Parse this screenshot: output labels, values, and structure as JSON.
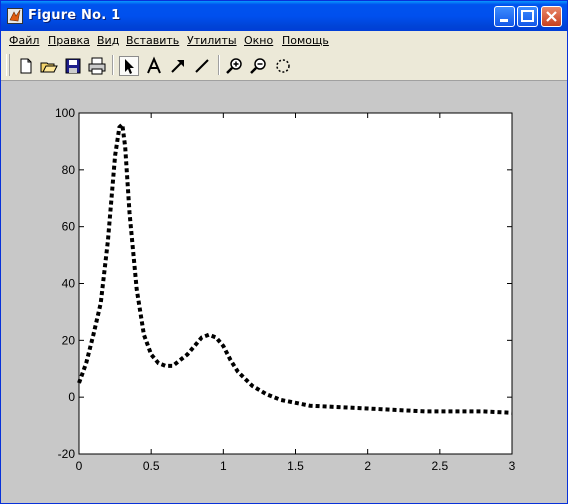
{
  "window": {
    "title": "Figure No. 1",
    "title_icon": "matlab-logo-icon",
    "controls": [
      "minimize-icon",
      "maximize-icon",
      "close-icon"
    ]
  },
  "menu": {
    "items": [
      "Файл",
      "Правка",
      "Вид",
      "Вставить",
      "Утилиты",
      "Окно",
      "Помощь"
    ]
  },
  "toolbar": {
    "buttons": [
      "new-file-icon",
      "open-folder-icon",
      "save-icon",
      "print-icon",
      "select-arrow-icon",
      "text-tool-icon",
      "arrow-tool-icon",
      "line-tool-icon",
      "zoom-in-icon",
      "zoom-out-icon",
      "rotate-3d-icon"
    ],
    "active": "select-arrow-icon"
  },
  "chart_data": {
    "type": "line",
    "title": "",
    "xlabel": "",
    "ylabel": "",
    "xlim": [
      0,
      3
    ],
    "ylim": [
      -20,
      100
    ],
    "xticks": [
      0,
      0.5,
      1,
      1.5,
      2,
      2.5,
      3
    ],
    "yticks": [
      -20,
      0,
      20,
      40,
      60,
      80,
      100
    ],
    "xtick_labels": [
      "0",
      "0.5",
      "1",
      "1.5",
      "2",
      "2.5",
      "3"
    ],
    "ytick_labels": [
      "-20",
      "0",
      "20",
      "40",
      "60",
      "80",
      "100"
    ],
    "grid": false,
    "line_style": "dotted",
    "line_color": "#000000",
    "series": [
      {
        "x": [
          0,
          0.05,
          0.1,
          0.15,
          0.2,
          0.25,
          0.28,
          0.3,
          0.32,
          0.35,
          0.4,
          0.45,
          0.5,
          0.55,
          0.6,
          0.65,
          0.7,
          0.75,
          0.8,
          0.85,
          0.9,
          0.95,
          1.0,
          1.05,
          1.1,
          1.2,
          1.3,
          1.4,
          1.5,
          1.6,
          1.8,
          2.0,
          2.2,
          2.4,
          2.6,
          2.8,
          3.0
        ],
        "y": [
          5,
          12,
          22,
          33,
          55,
          85,
          95,
          96,
          88,
          65,
          38,
          22,
          15,
          12,
          11,
          11,
          13,
          15,
          18,
          21,
          22,
          21,
          18,
          13,
          9,
          4,
          1,
          -1,
          -2,
          -3,
          -3.5,
          -4,
          -4.5,
          -5,
          -5,
          -5,
          -5.5
        ]
      }
    ]
  }
}
